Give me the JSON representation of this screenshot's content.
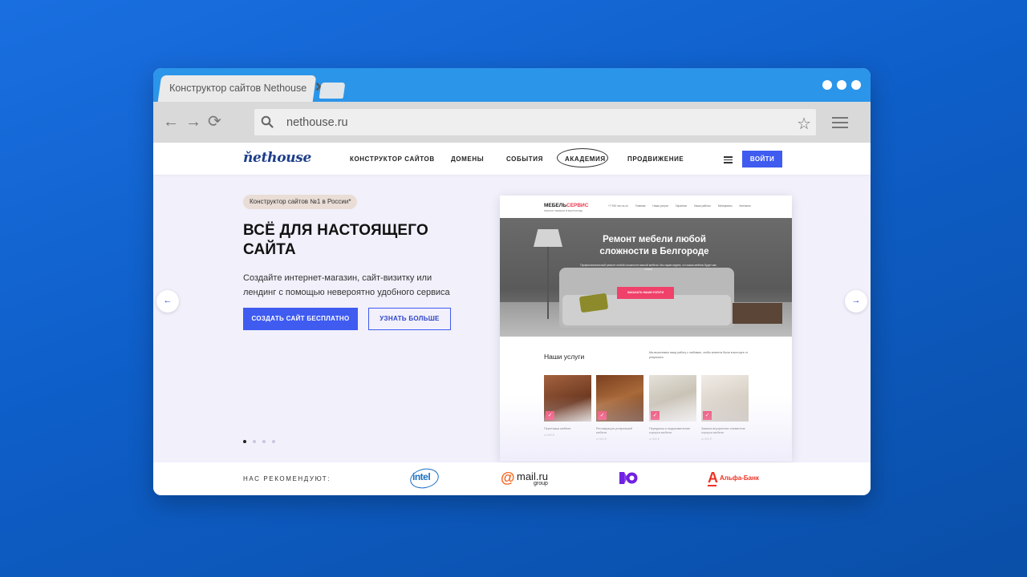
{
  "browser": {
    "tab_title": "Конструктор сайтов Nethouse",
    "tab_close": "✕",
    "url": "nethouse.ru",
    "back": "←",
    "forward": "→",
    "reload": "⟳",
    "star": "☆"
  },
  "site": {
    "logo": "ňethouse",
    "menu": [
      "КОНСТРУКТОР САЙТОВ",
      "ДОМЕНЫ",
      "СОБЫТИЯ",
      "АКАДЕМИЯ",
      "ПРОДВИЖЕНИЕ"
    ],
    "login_label": "ВОЙТИ"
  },
  "hero": {
    "badge": "Конструктор сайтов №1 в России*",
    "title": "ВСЁ ДЛЯ НАСТОЯЩЕГО САЙТА",
    "subtitle": "Создайте интернет-магазин, сайт-визитку или лендинг с помощью невероятно удобного сервиса",
    "primary_button": "СОЗДАТЬ САЙТ БЕСПЛАТНО",
    "secondary_button": "УЗНАТЬ БОЛЬШЕ",
    "prev_arrow": "←",
    "next_arrow": "→",
    "slide_count": 4,
    "active_slide": 1
  },
  "preview": {
    "logo_a": "МЕБЕЛЬ",
    "logo_b": "СЕРВИС",
    "logo_sub": "РЕМОНТ МЕБЕЛИ В БЕЛГОРОДЕ",
    "menu": [
      "+7 910 xxx-xx-xx",
      "Главная",
      "Наши услуги",
      "Гарантии",
      "Наши работы",
      "Материалы",
      "Контакты"
    ],
    "hero_title": "Ремонт мебели любой сложности в Белгороде",
    "hero_subtitle": "Профессиональный ремонт любой сложности мягкой мебели. Мы гарантируем, что ваша мебель будет как новая",
    "hero_button": "ЗАКАЗАТЬ НАШИ УСЛУГИ",
    "services_title": "Наши услуги",
    "services_desc": "Мы выполняем нашу работу с любовью, чтобы клиенты были в восторге от результата",
    "cards": [
      {
        "title": "Перетяжка мебели",
        "price": "от 500 ₽"
      },
      {
        "title": "Реставрация устаревшей мебели",
        "price": "от 500 ₽"
      },
      {
        "title": "Переделка и видоизменение корпуса мебели",
        "price": "от 500 ₽"
      },
      {
        "title": "Замена внутренних элементов корпуса мебели",
        "price": "от 500 ₽"
      }
    ]
  },
  "recommend": {
    "label": "НАС РЕКОМЕНДУЮТ:",
    "partners": [
      "intel",
      "mail.ru",
      "group",
      "Альфа-Банк"
    ]
  },
  "colors": {
    "background": "#1466d6",
    "tab_bar": "#2b95e9",
    "accent": "#3f5bf0",
    "hero_bg": "#f1f0fb",
    "preview_accent": "#f0416a",
    "alfa_red": "#ef3124"
  },
  "icons": [
    "search-icon",
    "star-icon",
    "menu-icon",
    "back-arrow-icon",
    "forward-arrow-icon",
    "reload-icon",
    "close-icon",
    "hamburger-icon",
    "check-icon"
  ]
}
